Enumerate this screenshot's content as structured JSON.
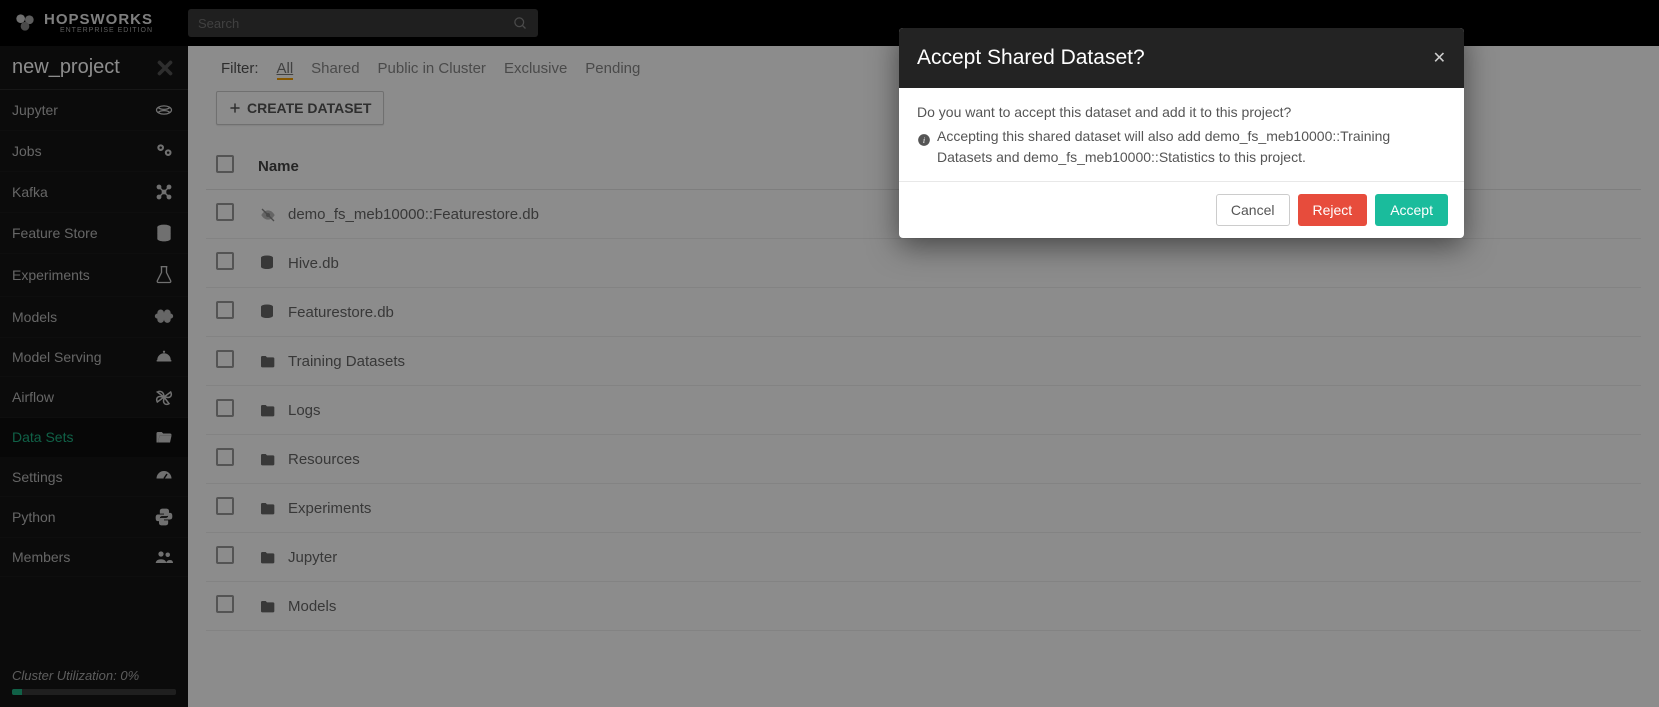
{
  "brand": {
    "name": "HOPSWORKS",
    "sub": "ENTERPRISE EDITION"
  },
  "search": {
    "placeholder": "Search"
  },
  "project_name": "new_project",
  "sidebar": {
    "items": [
      {
        "label": "Jupyter",
        "icon": "jupyter"
      },
      {
        "label": "Jobs",
        "icon": "cogs"
      },
      {
        "label": "Kafka",
        "icon": "share"
      },
      {
        "label": "Feature Store",
        "icon": "database"
      },
      {
        "label": "Experiments",
        "icon": "flask"
      },
      {
        "label": "Models",
        "icon": "brain"
      },
      {
        "label": "Model Serving",
        "icon": "cloche"
      },
      {
        "label": "Airflow",
        "icon": "pinwheel"
      },
      {
        "label": "Data Sets",
        "icon": "folder-open",
        "active": true
      },
      {
        "label": "Settings",
        "icon": "dashboard"
      },
      {
        "label": "Python",
        "icon": "python"
      },
      {
        "label": "Members",
        "icon": "users"
      }
    ]
  },
  "cluster": {
    "label": "Cluster Utilization: 0%",
    "percent": 6
  },
  "filters": {
    "label": "Filter:",
    "items": [
      "All",
      "Shared",
      "Public in Cluster",
      "Exclusive",
      "Pending"
    ],
    "active": "All"
  },
  "create_label": "CREATE DATASET",
  "table": {
    "columns": [
      "Name"
    ],
    "rows": [
      {
        "name": "demo_fs_meb10000::Featurestore.db",
        "icon": "eye-slash"
      },
      {
        "name": "Hive.db",
        "icon": "database"
      },
      {
        "name": "Featurestore.db",
        "icon": "database"
      },
      {
        "name": "Training Datasets",
        "icon": "folder"
      },
      {
        "name": "Logs",
        "icon": "folder"
      },
      {
        "name": "Resources",
        "icon": "folder"
      },
      {
        "name": "Experiments",
        "icon": "folder"
      },
      {
        "name": "Jupyter",
        "icon": "folder"
      },
      {
        "name": "Models",
        "icon": "folder"
      }
    ]
  },
  "modal": {
    "title": "Accept Shared Dataset?",
    "question": "Do you want to accept this dataset and add it to this project?",
    "info": "Accepting this shared dataset will also add demo_fs_meb10000::Training Datasets and demo_fs_meb10000::Statistics to this project.",
    "cancel": "Cancel",
    "reject": "Reject",
    "accept": "Accept"
  }
}
